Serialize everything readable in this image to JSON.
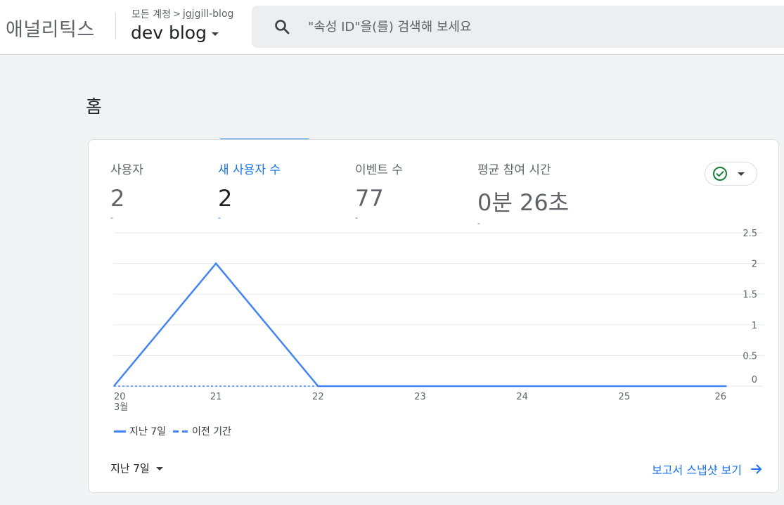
{
  "header": {
    "product_name": "애널리틱스",
    "breadcrumb_account": "모든 계정",
    "breadcrumb_separator": ">",
    "breadcrumb_property": "jgjgill-blog",
    "property_name": "dev blog"
  },
  "search": {
    "placeholder": "\"속성 ID\"을(를) 검색해 보세요",
    "value": ""
  },
  "page": {
    "title": "홈"
  },
  "metrics": [
    {
      "label": "사용자",
      "value": "2",
      "change": "-"
    },
    {
      "label": "새 사용자 수",
      "value": "2",
      "change": "-",
      "active": true
    },
    {
      "label": "이벤트 수",
      "value": "77",
      "change": "-"
    },
    {
      "label": "평균 참여 시간",
      "value": "0분 26초",
      "change": "-"
    }
  ],
  "status_chip": {
    "icon": "check-circle-icon",
    "color": "#188038"
  },
  "chart_data": {
    "type": "line",
    "categories": [
      "20",
      "21",
      "22",
      "23",
      "24",
      "25",
      "26"
    ],
    "x_month_label": "3월",
    "series": [
      {
        "name": "지난 7일",
        "values": [
          0,
          2,
          0,
          0,
          0,
          0,
          0
        ],
        "style": "solid"
      },
      {
        "name": "이전 기간",
        "values": [
          0,
          0,
          0,
          0,
          0,
          0,
          0
        ],
        "style": "dashed"
      }
    ],
    "y_ticks": [
      "2.5",
      "2",
      "1.5",
      "1",
      "0.5",
      "0"
    ],
    "ylim": [
      0,
      2.5
    ],
    "y_axis_side": "right",
    "grid": true,
    "legend_position": "bottom-left",
    "color": "#4285f4"
  },
  "footer": {
    "range_label": "지난 7일",
    "report_link": "보고서 스냅샷 보기"
  },
  "colors": {
    "accent": "#1a73e8",
    "series": "#4285f4",
    "success": "#188038"
  }
}
